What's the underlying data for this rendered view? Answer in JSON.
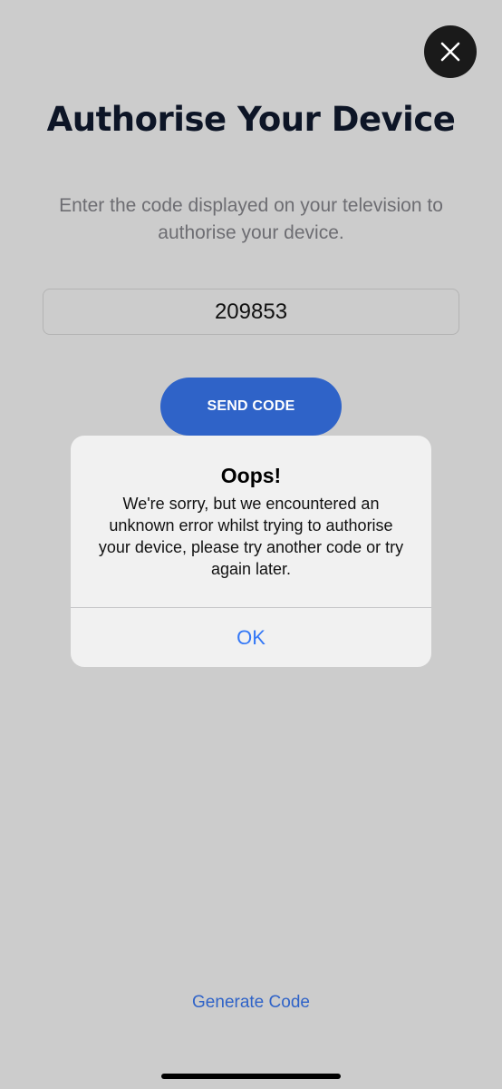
{
  "header": {
    "close_icon": "close-icon",
    "title": "Authorise Your Device"
  },
  "instructions": "Enter the code displayed on your television to authorise your device.",
  "code_input": {
    "value": "209853"
  },
  "send_button": {
    "label": "SEND CODE"
  },
  "alert": {
    "title": "Oops!",
    "message": "We're sorry, but we encountered an unknown error whilst trying to authorise your device, please try another code or try again later.",
    "ok_label": "OK"
  },
  "footer": {
    "generate_code_label": "Generate Code"
  },
  "colors": {
    "background": "#cccccc",
    "accent": "#2f63c8",
    "alert_action": "#3478f6",
    "title": "#0d1526"
  }
}
